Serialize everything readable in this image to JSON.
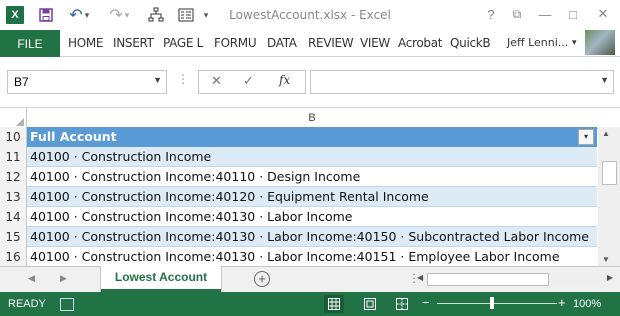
{
  "window": {
    "title": "LowestAccount.xlsx - Excel",
    "help": "?",
    "restore": "⧉",
    "minimize": "—",
    "maximize": "□",
    "close": "✕"
  },
  "qat": {
    "app_icon_label": "X",
    "save": "💾",
    "undo": "↶",
    "undo_drop": "▾",
    "redo": "↷",
    "redo_drop": "▾",
    "network": "☷",
    "form": "☰",
    "customize": "▾"
  },
  "ribbon": {
    "file": "FILE",
    "tabs": [
      "HOME",
      "INSERT",
      "PAGE L",
      "FORMU",
      "DATA",
      "REVIEW",
      "VIEW",
      "Acrobat",
      "QuickB"
    ],
    "user": "Jeff Lenni...",
    "user_drop": "▾"
  },
  "formula_bar": {
    "name_box": "B7",
    "name_arrow": "▼",
    "cancel": "✕",
    "enter": "✓",
    "fx": "fx",
    "formula": "",
    "expand": "▼"
  },
  "grid": {
    "column": "B",
    "rows": [
      {
        "num": "10",
        "text": "Full Account",
        "style": "header"
      },
      {
        "num": "11",
        "text": "40100 · Construction Income",
        "style": "band"
      },
      {
        "num": "12",
        "text": "40100 · Construction Income:40110 · Design Income",
        "style": "plain"
      },
      {
        "num": "13",
        "text": "40100 · Construction Income:40120 · Equipment Rental Income",
        "style": "band"
      },
      {
        "num": "14",
        "text": "40100 · Construction Income:40130 · Labor Income",
        "style": "plain"
      },
      {
        "num": "15",
        "text": "40100 · Construction Income:40130 · Labor Income:40150 · Subcontracted Labor Income",
        "style": "band"
      },
      {
        "num": "16",
        "text": "40100 · Construction Income:40130 · Labor Income:40151 · Employee Labor Income",
        "style": "plain"
      }
    ],
    "filter_arrow": "▾"
  },
  "sheets": {
    "prev": "◀",
    "next": "▶",
    "active": "Lowest Account",
    "add": "+",
    "more": "⋮"
  },
  "status": {
    "ready": "READY",
    "zoom_minus": "−",
    "zoom_plus": "+",
    "zoom": "100%",
    "zoom_fraction": 0.46
  },
  "colors": {
    "accent": "#217346",
    "table_header": "#5b9bd5",
    "band": "#ddebf7"
  }
}
